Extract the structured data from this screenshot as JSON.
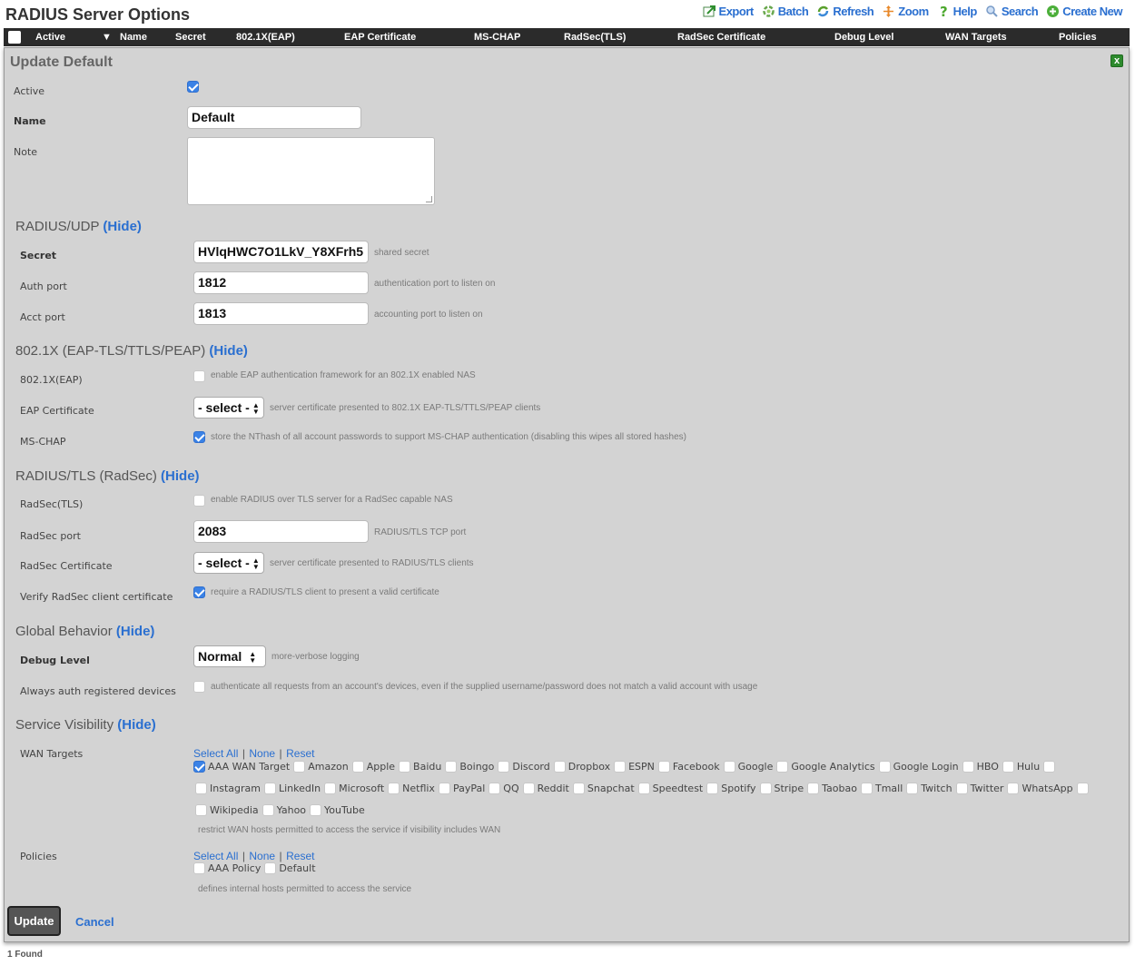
{
  "page": {
    "title": "RADIUS Server Options",
    "found": "1 Found"
  },
  "toolbar": {
    "export": "Export",
    "batch": "Batch",
    "refresh": "Refresh",
    "zoom": "Zoom",
    "help": "Help",
    "search": "Search",
    "create_new": "Create New"
  },
  "columns": [
    "Active",
    "Name",
    "Secret",
    "802.1X(EAP)",
    "EAP Certificate",
    "MS-CHAP",
    "RadSec(TLS)",
    "RadSec Certificate",
    "Debug Level",
    "WAN Targets",
    "Policies"
  ],
  "form": {
    "title": "Update Default",
    "active_label": "Active",
    "active": true,
    "name_label": "Name",
    "name_value": "Default",
    "note_label": "Note",
    "note_value": ""
  },
  "radius_udp": {
    "title": "RADIUS/UDP",
    "hide": "(Hide)",
    "secret_label": "Secret",
    "secret_value": "HVlqHWC7O1LkV_Y8XFrh5",
    "secret_hint": "shared secret",
    "auth_label": "Auth port",
    "auth_value": "1812",
    "auth_hint": "authentication port to listen on",
    "acct_label": "Acct port",
    "acct_value": "1813",
    "acct_hint": "accounting port to listen on"
  },
  "eap": {
    "title": "802.1X (EAP-TLS/TTLS/PEAP)",
    "hide": "(Hide)",
    "eap_label": "802.1X(EAP)",
    "eap_hint": "enable EAP authentication framework for an 802.1X enabled NAS",
    "eap_checked": false,
    "cert_label": "EAP Certificate",
    "cert_value": "- select -",
    "cert_hint": "server certificate presented to 802.1X EAP-TLS/TTLS/PEAP clients",
    "mschap_label": "MS-CHAP",
    "mschap_hint": "store the NThash of all account passwords to support MS-CHAP authentication (disabling this wipes all stored hashes)",
    "mschap_checked": true
  },
  "radsec": {
    "title": "RADIUS/TLS (RadSec)",
    "hide": "(Hide)",
    "tls_label": "RadSec(TLS)",
    "tls_hint": "enable RADIUS over TLS server for a RadSec capable NAS",
    "tls_checked": false,
    "port_label": "RadSec port",
    "port_value": "2083",
    "port_hint": "RADIUS/TLS TCP port",
    "cert_label": "RadSec Certificate",
    "cert_value": "- select -",
    "cert_hint": "server certificate presented to RADIUS/TLS clients",
    "verify_label": "Verify RadSec client certificate",
    "verify_hint": "require a RADIUS/TLS client to present a valid certificate",
    "verify_checked": true
  },
  "global": {
    "title": "Global Behavior",
    "hide": "(Hide)",
    "debug_label": "Debug Level",
    "debug_value": "Normal",
    "debug_hint": "more-verbose logging",
    "always_label": "Always auth registered devices",
    "always_hint": "authenticate all requests from an account's devices, even if the supplied username/password does not match a valid account with usage",
    "always_checked": false
  },
  "visibility": {
    "title": "Service Visibility",
    "hide": "(Hide)",
    "wan_label": "WAN Targets",
    "select_all": "Select All",
    "none": "None",
    "reset": "Reset",
    "wan_row1": [
      {
        "label": "AAA WAN Target",
        "checked": true
      },
      {
        "label": "Amazon"
      },
      {
        "label": "Apple"
      },
      {
        "label": "Baidu"
      },
      {
        "label": "Boingo"
      },
      {
        "label": "Discord"
      },
      {
        "label": "Dropbox"
      },
      {
        "label": "ESPN"
      },
      {
        "label": "Facebook"
      },
      {
        "label": "Google"
      },
      {
        "label": "Google Analytics"
      },
      {
        "label": "Google Login"
      },
      {
        "label": "HBO"
      },
      {
        "label": "Hulu"
      },
      {
        "label": ""
      }
    ],
    "wan_row2": [
      {
        "label": "Instagram"
      },
      {
        "label": "LinkedIn"
      },
      {
        "label": "Microsoft"
      },
      {
        "label": "Netflix"
      },
      {
        "label": "PayPal"
      },
      {
        "label": "QQ"
      },
      {
        "label": "Reddit"
      },
      {
        "label": "Snapchat"
      },
      {
        "label": "Speedtest"
      },
      {
        "label": "Spotify"
      },
      {
        "label": "Stripe"
      },
      {
        "label": "Taobao"
      },
      {
        "label": "Tmall"
      },
      {
        "label": "Twitch"
      },
      {
        "label": "Twitter"
      },
      {
        "label": "WhatsApp"
      },
      {
        "label": ""
      }
    ],
    "wan_row3": [
      {
        "label": "Wikipedia"
      },
      {
        "label": "Yahoo"
      },
      {
        "label": "YouTube"
      }
    ],
    "wan_hint": "restrict WAN hosts permitted to access the service if visibility includes WAN",
    "policies_label": "Policies",
    "policies": [
      {
        "label": "AAA Policy"
      },
      {
        "label": "Default"
      }
    ],
    "policies_hint": "defines internal hosts permitted to access the service"
  },
  "buttons": {
    "update": "Update",
    "cancel": "Cancel"
  },
  "colors": {
    "accent": "#2a6fd0",
    "panel": "#d3d3d3",
    "header": "#2b2b2b",
    "check": "#3a82e6"
  }
}
